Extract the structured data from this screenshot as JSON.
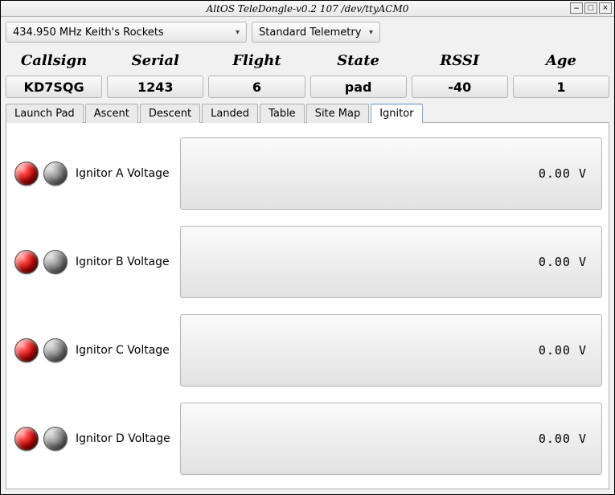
{
  "title": "AltOS TeleDongle-v0.2 107 /dev/ttyACM0",
  "dropdowns": {
    "frequency": "434.950 MHz Keith's Rockets",
    "telemetry": "Standard Telemetry"
  },
  "status": {
    "headers": [
      "Callsign",
      "Serial",
      "Flight",
      "State",
      "RSSI",
      "Age"
    ],
    "values": [
      "KD7SQG",
      "1243",
      "6",
      "pad",
      "-40",
      "1"
    ]
  },
  "tabs": [
    "Launch Pad",
    "Ascent",
    "Descent",
    "Landed",
    "Table",
    "Site Map",
    "Ignitor"
  ],
  "active_tab": 6,
  "ignitors": [
    {
      "label": "Ignitor A Voltage",
      "value": "0.00 V"
    },
    {
      "label": "Ignitor B Voltage",
      "value": "0.00 V"
    },
    {
      "label": "Ignitor C Voltage",
      "value": "0.00 V"
    },
    {
      "label": "Ignitor D Voltage",
      "value": "0.00 V"
    }
  ]
}
